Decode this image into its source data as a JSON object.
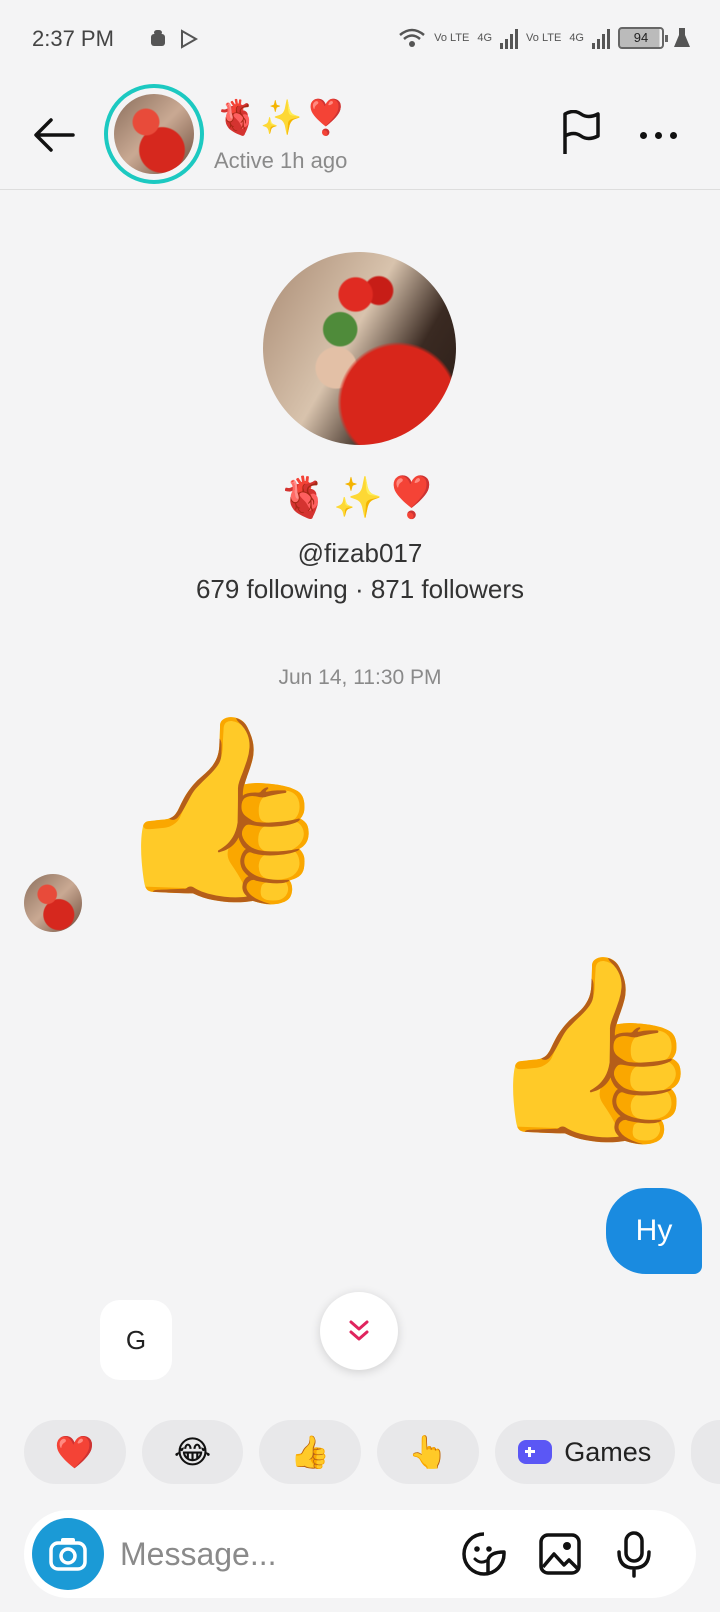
{
  "status_bar": {
    "time": "2:37 PM",
    "battery": "94",
    "network_labels": [
      "Vo LTE",
      "4G",
      "Vo LTE",
      "4G"
    ]
  },
  "header": {
    "name": "🫀✨❣️",
    "status": "Active 1h ago"
  },
  "profile": {
    "name": "🫀✨❣️",
    "handle": "@fizab017",
    "stats": "679 following · 871 followers"
  },
  "conversation": {
    "timestamp": "Jun 14, 11:30 PM",
    "received_emoji": "👍",
    "sent_emoji": "👍",
    "sent_text": "Hy",
    "typing_preview": "G"
  },
  "quick_replies": [
    "❤️",
    "😂",
    "👍",
    "👆"
  ],
  "games_label": "Games",
  "composer": {
    "placeholder": "Message..."
  },
  "colors": {
    "accent_blue": "#1a8be0",
    "story_ring": "#1cc9c1",
    "camera_button": "#1b9ad6",
    "games_icon": "#5b57f5",
    "scroll_chevron": "#e0245e"
  }
}
